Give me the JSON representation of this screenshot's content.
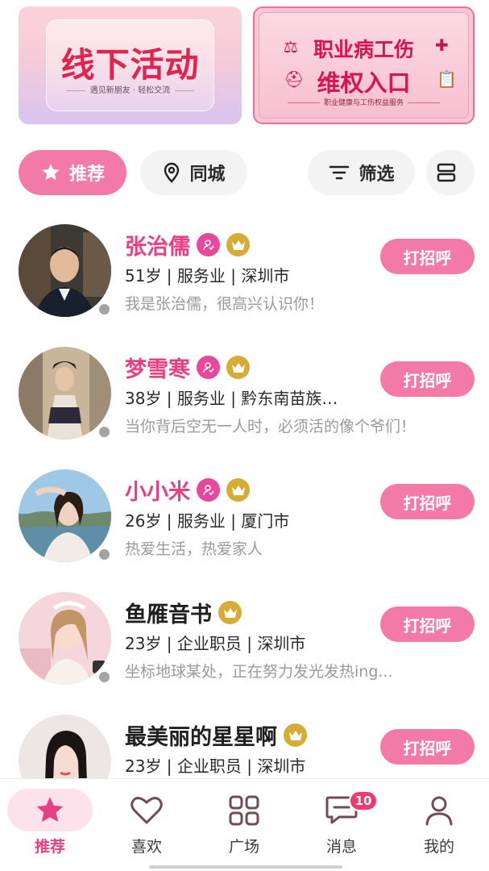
{
  "banners": {
    "left": {
      "title": "线下活动",
      "subtitle": "遇见新朋友 · 轻松交流"
    },
    "right": {
      "line1": "职业病工伤",
      "line2": "维权入口",
      "subtitle": "职业健康与工伤权益服务"
    }
  },
  "filters": {
    "recommend": "推荐",
    "same_city": "同城",
    "filter": "筛选"
  },
  "users": [
    {
      "name": "张治儒",
      "info": "51岁 | 服务业 | 深圳市",
      "signature": "我是张治儒，很高兴认识你！",
      "action": "打招呼",
      "verified": true,
      "vip": true
    },
    {
      "name": "梦雪寒",
      "info": "38岁 | 服务业 | 黔东南苗族…",
      "signature": "当你背后空无一人时，必须活的像个爷们！",
      "action": "打招呼",
      "verified": true,
      "vip": true
    },
    {
      "name": "小小米",
      "info": "26岁 | 服务业 | 厦门市",
      "signature": "热爱生活，热爱家人",
      "action": "打招呼",
      "verified": true,
      "vip": true
    },
    {
      "name": "鱼雁音书",
      "info": "23岁 | 企业职员 | 深圳市",
      "signature": "坐标地球某处，正在努力发光发热ing...",
      "action": "打招呼",
      "verified": false,
      "vip": true
    },
    {
      "name": "最美丽的星星啊",
      "info": "23岁 | 企业职员 | 深圳市",
      "signature": "",
      "action": "打招呼",
      "verified": false,
      "vip": true
    }
  ],
  "tabbar": {
    "items": [
      {
        "label": "推荐",
        "icon": "star-icon",
        "active": true
      },
      {
        "label": "喜欢",
        "icon": "heart-icon"
      },
      {
        "label": "广场",
        "icon": "grid-icon"
      },
      {
        "label": "消息",
        "icon": "chat-icon",
        "badge": "10"
      },
      {
        "label": "我的",
        "icon": "person-icon"
      }
    ]
  },
  "colors": {
    "accent": "#f37aa6",
    "name_pink": "#e83f84",
    "gold": "#d7ac34"
  }
}
